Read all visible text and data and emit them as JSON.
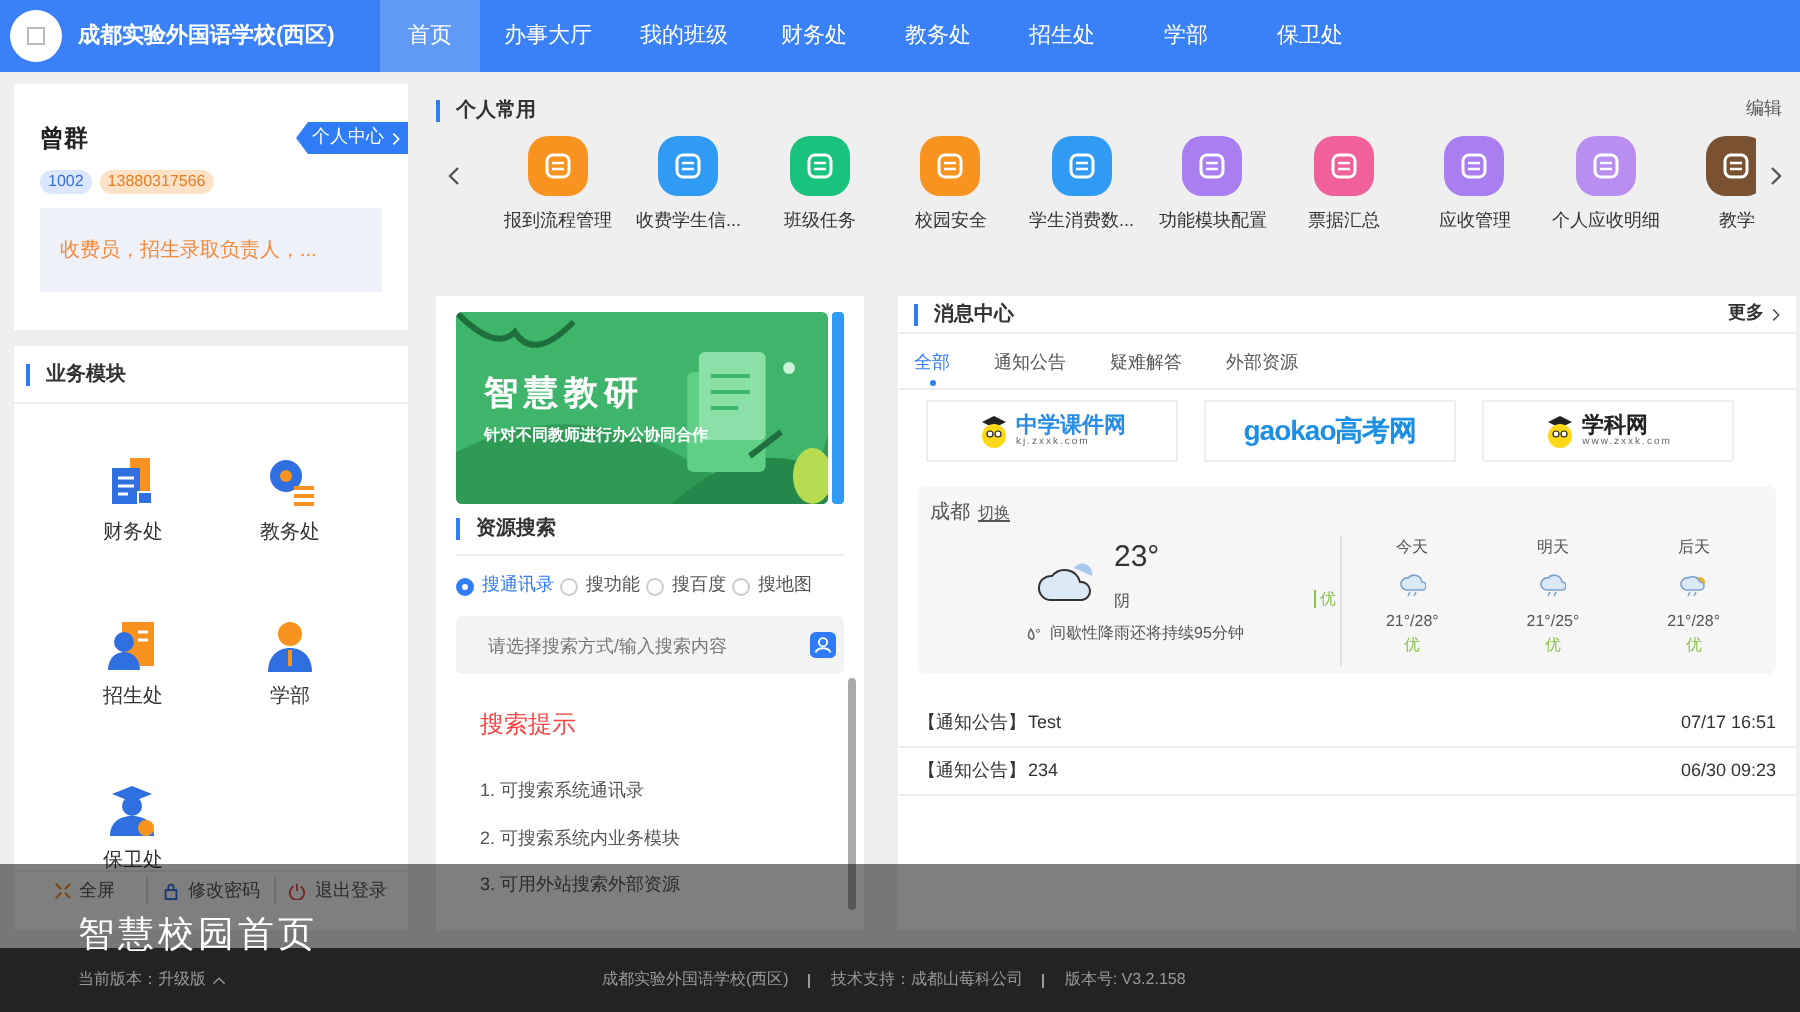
{
  "header": {
    "school_name": "成都实验外国语学校(西区)",
    "nav": [
      {
        "label": "首页",
        "selected": true
      },
      {
        "label": "办事大厅",
        "selected": false
      },
      {
        "label": "我的班级",
        "selected": false
      },
      {
        "label": "财务处",
        "selected": false
      },
      {
        "label": "教务处",
        "selected": false
      },
      {
        "label": "招生处",
        "selected": false
      },
      {
        "label": "学部",
        "selected": false
      },
      {
        "label": "保卫处",
        "selected": false
      }
    ]
  },
  "profile": {
    "name": "曾群",
    "center_button": "个人中心",
    "id_tag": "1002",
    "phone_tag": "13880317566",
    "roles": "收费员，招生录取负责人，..."
  },
  "business_modules": {
    "title": "业务模块",
    "items": [
      {
        "label": "财务处"
      },
      {
        "label": "教务处"
      },
      {
        "label": "招生处"
      },
      {
        "label": "学部"
      },
      {
        "label": "保卫处"
      }
    ],
    "tools": [
      "全屏",
      "修改密码",
      "退出登录"
    ]
  },
  "quick_access": {
    "title": "个人常用",
    "edit": "编辑",
    "items": [
      {
        "label": "报到流程管理",
        "color": "#f7931e"
      },
      {
        "label": "收费学生信...",
        "color": "#2f9bf2"
      },
      {
        "label": "班级任务",
        "color": "#19c37d"
      },
      {
        "label": "校园安全",
        "color": "#f7931e"
      },
      {
        "label": "学生消费数...",
        "color": "#2f9bf2"
      },
      {
        "label": "功能模块配置",
        "color": "#a97ef0"
      },
      {
        "label": "票据汇总",
        "color": "#f0609a"
      },
      {
        "label": "应收管理",
        "color": "#a97ef0"
      },
      {
        "label": "个人应收明细",
        "color": "#b88ef0"
      },
      {
        "label": "教学",
        "color": "#7a5232"
      }
    ]
  },
  "banner": {
    "title": "智慧教研",
    "subtitle": "针对不同教师进行办公协同合作"
  },
  "resource_search": {
    "title": "资源搜索",
    "options": [
      {
        "label": "搜通讯录",
        "selected": true
      },
      {
        "label": "搜功能",
        "selected": false
      },
      {
        "label": "搜百度",
        "selected": false
      },
      {
        "label": "搜地图",
        "selected": false
      }
    ],
    "placeholder": "请选择搜索方式/输入搜索内容",
    "tips_title": "搜索提示",
    "tips": [
      "1. 可搜索系统通讯录",
      "2. 可搜索系统内业务模块",
      "3. 可用外站搜索外部资源"
    ]
  },
  "messages": {
    "title": "消息中心",
    "more": "更多",
    "tabs": [
      {
        "label": "全部",
        "selected": true
      },
      {
        "label": "通知公告",
        "selected": false
      },
      {
        "label": "疑难解答",
        "selected": false
      },
      {
        "label": "外部资源",
        "selected": false
      }
    ],
    "links": [
      {
        "kind": "mascot",
        "name": "中学课件网",
        "url": "kj.zxxk.com"
      },
      {
        "kind": "wordmark",
        "name": "gaokao高考网"
      },
      {
        "kind": "mascot",
        "name": "学科网",
        "url": "www.zxxk.com"
      }
    ],
    "weather": {
      "city": "成都",
      "switch": "切换",
      "temp": "23°",
      "condition": "阴",
      "air": "优",
      "note": "间歇性降雨还将持续95分钟",
      "days": [
        {
          "label": "今天",
          "temp": "21°/28°",
          "air": "优",
          "kind": "rain"
        },
        {
          "label": "明天",
          "temp": "21°/25°",
          "air": "优",
          "kind": "rain"
        },
        {
          "label": "后天",
          "temp": "21°/28°",
          "air": "优",
          "kind": "sunrain"
        }
      ]
    },
    "notices": [
      {
        "tag": "【通知公告】",
        "title": "Test",
        "time": "07/17 16:51"
      },
      {
        "tag": "【通知公告】",
        "title": "234",
        "time": "06/30 09:23"
      }
    ]
  },
  "caption": "智慧校园首页",
  "footer": {
    "version": "当前版本：升级版",
    "items": [
      "成都实验外国语学校(西区)",
      "技术支持：成都山莓科公司",
      "版本号: V3.2.158"
    ]
  }
}
